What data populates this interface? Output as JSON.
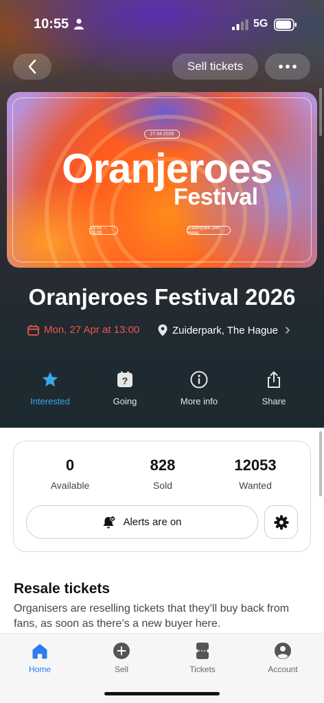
{
  "status_bar": {
    "time": "10:55",
    "network": "5G"
  },
  "nav": {
    "sell_label": "Sell tickets"
  },
  "poster": {
    "date": "27.04.2026",
    "title": "Oranjeroes",
    "subtitle": "Festival",
    "hours": "13:00 – 23:00",
    "venue": "Zuiderpark Den Haag"
  },
  "event": {
    "title": "Oranjeroes Festival 2026",
    "date": "Mon, 27 Apr at 13:00",
    "location": "Zuiderpark, The Hague"
  },
  "actions": [
    {
      "label": "Interested",
      "icon": "star-icon"
    },
    {
      "label": "Going",
      "icon": "question-badge-icon"
    },
    {
      "label": "More info",
      "icon": "info-icon"
    },
    {
      "label": "Share",
      "icon": "share-icon"
    }
  ],
  "stats": [
    {
      "value": "0",
      "label": "Available"
    },
    {
      "value": "828",
      "label": "Sold"
    },
    {
      "value": "12053",
      "label": "Wanted"
    }
  ],
  "alerts": {
    "label": "Alerts are on"
  },
  "resale": {
    "title": "Resale tickets",
    "text": "Organisers are reselling tickets that they’ll buy back from fans, as soon as there’s a new buyer here."
  },
  "tabs": [
    {
      "label": "Home",
      "icon": "home-icon"
    },
    {
      "label": "Sell",
      "icon": "plus-circle-icon"
    },
    {
      "label": "Tickets",
      "icon": "ticket-icon"
    },
    {
      "label": "Account",
      "icon": "person-icon"
    }
  ],
  "colors": {
    "accent": "#3aa7e8",
    "date_red": "#f0564a",
    "tab_active": "#2a7cf0"
  }
}
